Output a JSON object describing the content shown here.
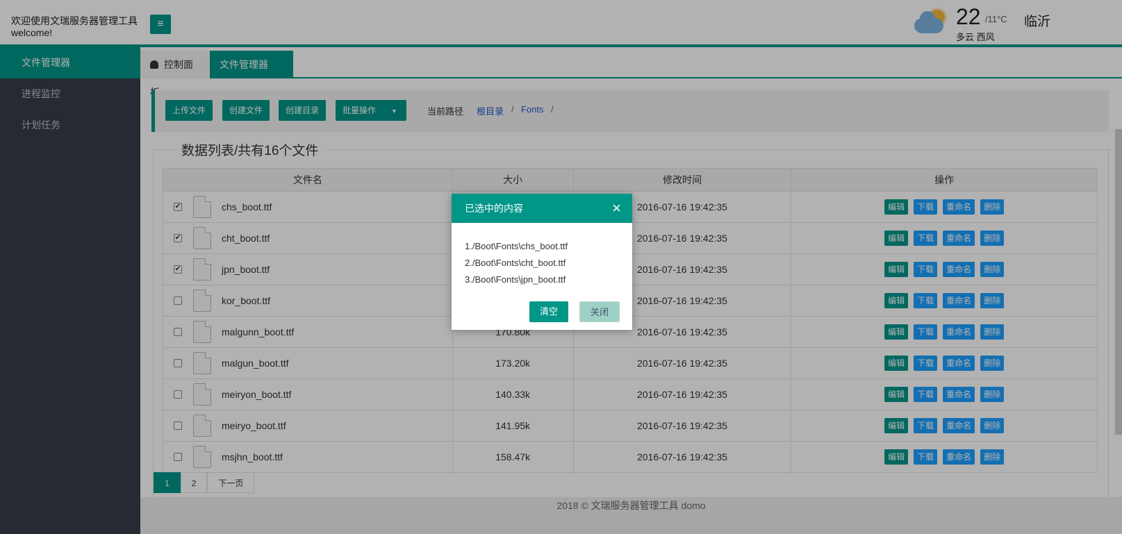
{
  "header": {
    "welcome_line1": "欢迎使用文瑞服务器管理工具",
    "welcome_line2": "welcome!",
    "menu_icon": "≡"
  },
  "weather": {
    "temp": "22",
    "range": "/11°C",
    "city": "临沂",
    "condition": "多云 西风",
    "icon": "partly-cloudy-icon"
  },
  "sidebar": {
    "items": [
      {
        "label": "文件管理器",
        "active": true
      },
      {
        "label": "进程监控",
        "active": false
      },
      {
        "label": "计划任务",
        "active": false
      }
    ]
  },
  "tabs": [
    {
      "label": "控制面板"
    },
    {
      "label": "文件管理器",
      "close": "✕"
    }
  ],
  "toolbar": {
    "upload": "上传文件",
    "create_file": "创建文件",
    "create_dir": "创建目录",
    "batch": "批量操作",
    "batch_caret": "▼",
    "path_label": "当前路径",
    "crumbs": [
      "根目录",
      "Fonts"
    ],
    "separator": "/"
  },
  "list": {
    "legend": "数据列表/共有16个文件",
    "headers": [
      "文件名",
      "大小",
      "修改时间",
      "操作"
    ],
    "actions": [
      "编辑",
      "下载",
      "重命名",
      "删除"
    ],
    "rows": [
      {
        "name": "chs_boot.ttf",
        "size": "",
        "time": "2016-07-16 19:42:35",
        "checked": true
      },
      {
        "name": "cht_boot.ttf",
        "size": "",
        "time": "2016-07-16 19:42:35",
        "checked": true
      },
      {
        "name": "jpn_boot.ttf",
        "size": "",
        "time": "2016-07-16 19:42:35",
        "checked": true
      },
      {
        "name": "kor_boot.ttf",
        "size": "",
        "time": "2016-07-16 19:42:35",
        "checked": false
      },
      {
        "name": "malgunn_boot.ttf",
        "size": "170.80k",
        "time": "2016-07-16 19:42:35",
        "checked": false
      },
      {
        "name": "malgun_boot.ttf",
        "size": "173.20k",
        "time": "2016-07-16 19:42:35",
        "checked": false
      },
      {
        "name": "meiryon_boot.ttf",
        "size": "140.33k",
        "time": "2016-07-16 19:42:35",
        "checked": false
      },
      {
        "name": "meiryo_boot.ttf",
        "size": "141.95k",
        "time": "2016-07-16 19:42:35",
        "checked": false
      },
      {
        "name": "msjhn_boot.ttf",
        "size": "158.47k",
        "time": "2016-07-16 19:42:35",
        "checked": false
      }
    ]
  },
  "pager": {
    "pages": [
      "1",
      "2"
    ],
    "next": "下一页"
  },
  "footer": {
    "text": "2018 ©  文瑞服务器管理工具  domo"
  },
  "modal": {
    "title": "已选中的内容",
    "close_icon": "×",
    "items": [
      "1./Boot\\Fonts\\chs_boot.ttf",
      "2./Boot\\Fonts\\cht_boot.ttf",
      "3./Boot\\Fonts\\jpn_boot.ttf"
    ],
    "clear": "清空",
    "close": "关闭"
  },
  "colors": {
    "accent": "#009688",
    "blue": "#1e9fff",
    "sidebar": "#393d49"
  }
}
